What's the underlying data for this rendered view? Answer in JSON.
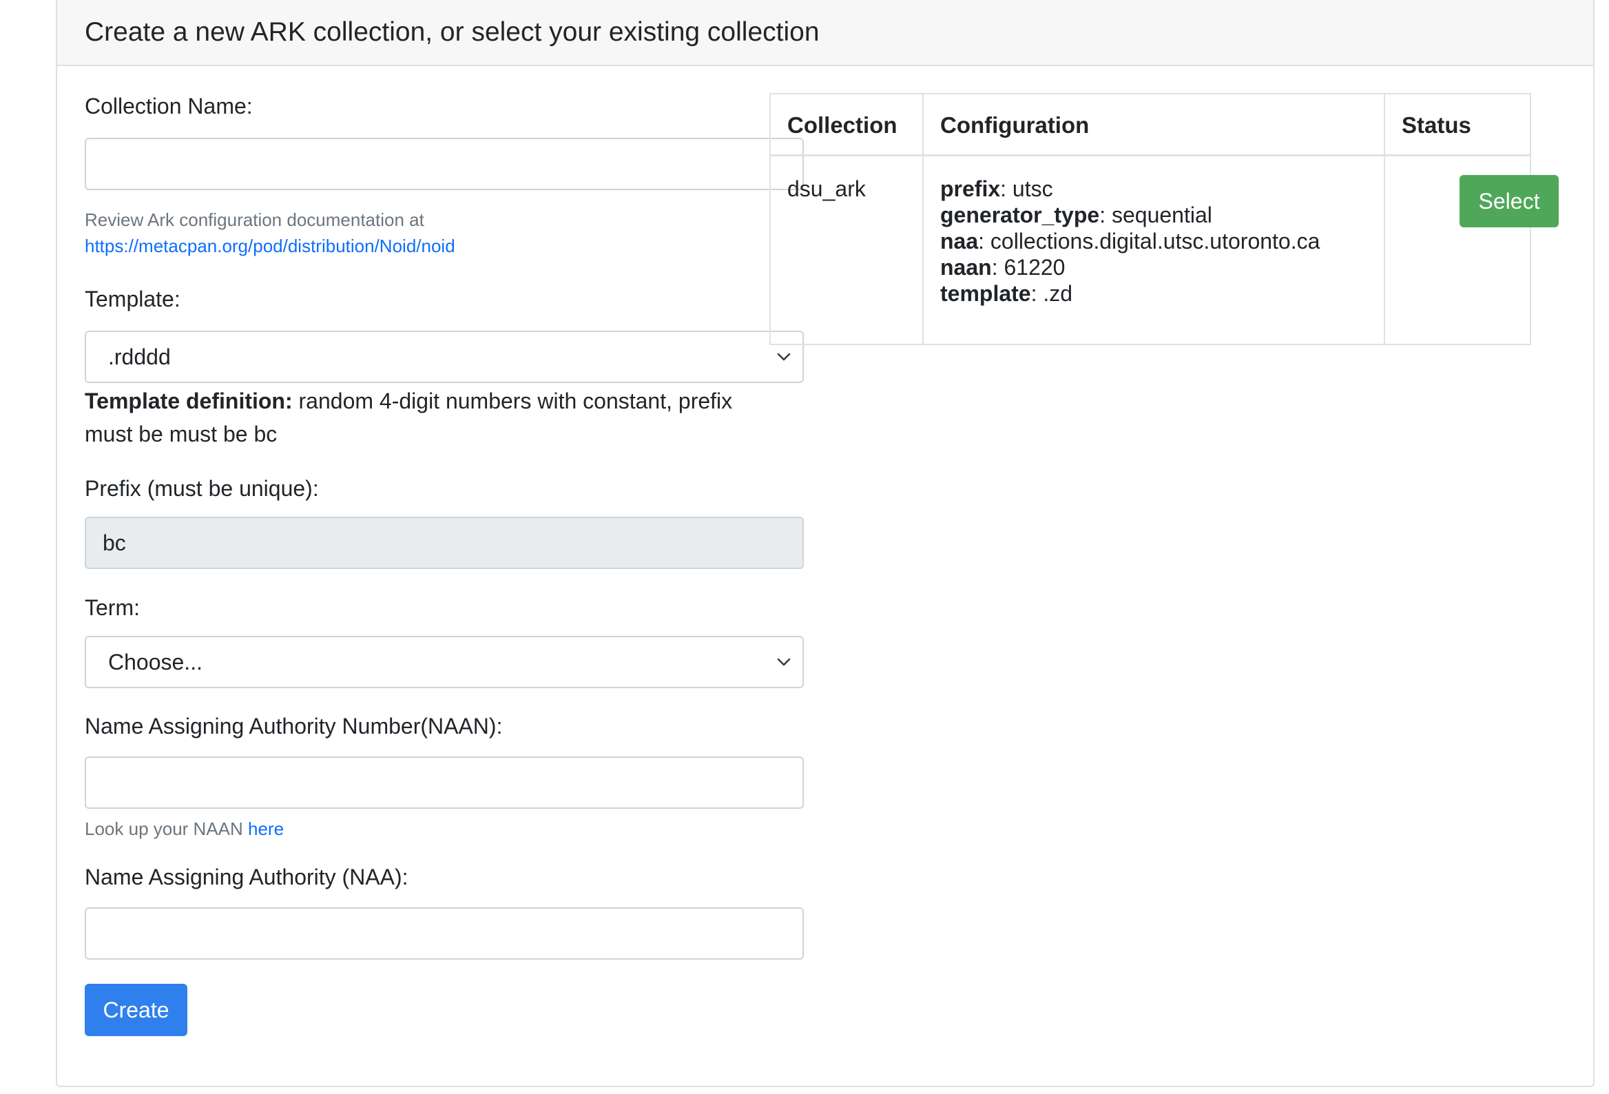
{
  "header": {
    "title": "Create a new ARK collection, or select your existing collection"
  },
  "form": {
    "collection_name": {
      "label": "Collection Name:",
      "value": ""
    },
    "doc_help": {
      "text": "Review Ark configuration documentation at",
      "link": "https://metacpan.org/pod/distribution/Noid/noid"
    },
    "template": {
      "label": "Template:",
      "selected": ".rdddd",
      "definition_label": "Template definition:",
      "definition_text": " random 4-digit numbers with constant, prefix must be must be bc"
    },
    "prefix": {
      "label": "Prefix (must be unique):",
      "value": "bc"
    },
    "term": {
      "label": "Term:",
      "selected": "Choose..."
    },
    "naan": {
      "label": "Name Assigning Authority Number(NAAN):",
      "value": "",
      "help_text": "Look up your NAAN ",
      "help_link": "here"
    },
    "naa": {
      "label": "Name Assigning Authority (NAA):",
      "value": ""
    },
    "create_label": "Create"
  },
  "table": {
    "headers": [
      "Collection",
      "Configuration",
      "Status"
    ],
    "rows": [
      {
        "collection": "dsu_ark",
        "config": [
          {
            "key": "prefix",
            "value": ": utsc"
          },
          {
            "key": "generator_type",
            "value": ": sequential"
          },
          {
            "key": "naa",
            "value": ": collections.digital.utsc.utoronto.ca"
          },
          {
            "key": "naan",
            "value": ": 61220"
          },
          {
            "key": "template",
            "value": ": .zd"
          }
        ],
        "status_button": "Select"
      }
    ]
  },
  "colors": {
    "primary": "#2f80ed",
    "success": "#4fa85a",
    "link": "#0d6efd",
    "header_bg": "#f7f7f7"
  }
}
